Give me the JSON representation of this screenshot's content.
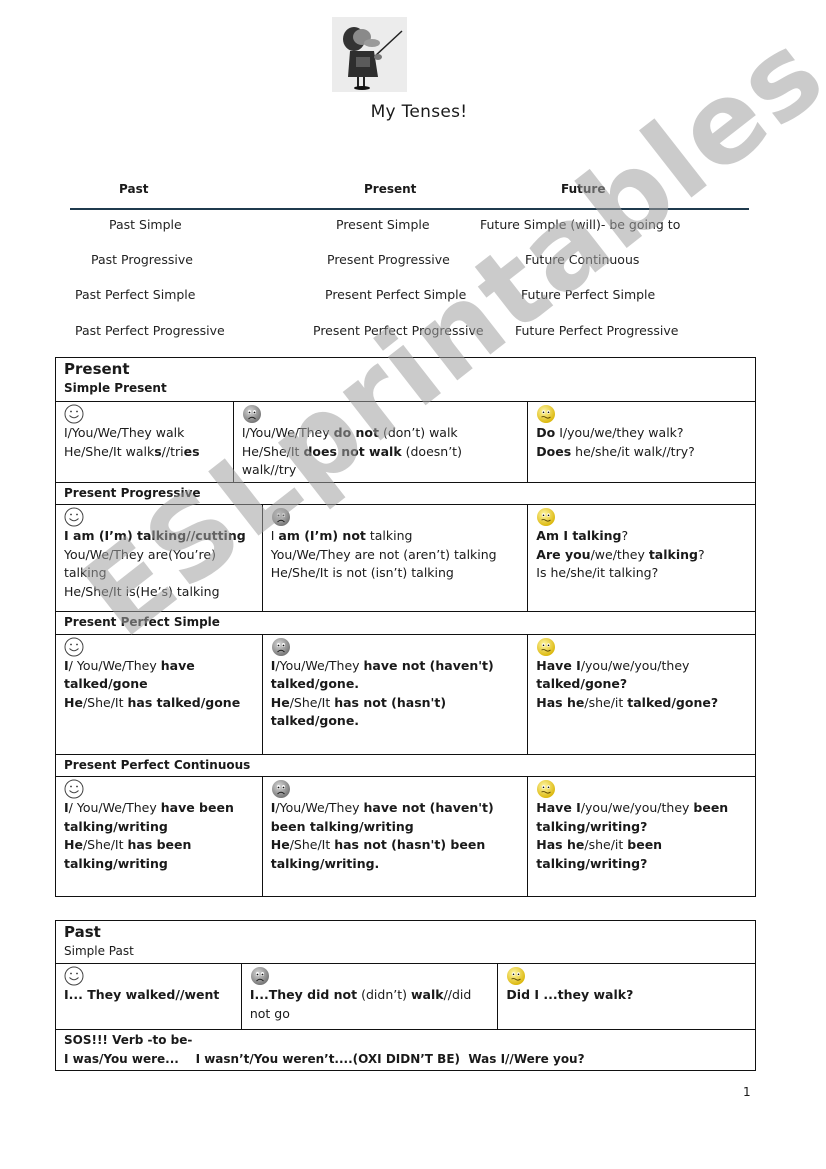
{
  "document": {
    "title": "My Tenses!",
    "page_number": "1",
    "watermark": "ESLprintables.com",
    "header_image": "teacher-with-pointer-image",
    "rule_color": "#1f3a4d"
  },
  "overview": {
    "headers": [
      "Past",
      "Present",
      "Future"
    ],
    "rows": [
      [
        "Past Simple",
        "Present Simple",
        "Future Simple (will)- be going to"
      ],
      [
        "Past Progressive",
        "Present Progressive",
        "Future Continuous"
      ],
      [
        "Past Perfect Simple",
        "Present Perfect Simple",
        "Future Perfect Simple"
      ],
      [
        "Past Perfect Progressive",
        "Present Perfect Progressive",
        "Future Perfect Progressive"
      ]
    ]
  },
  "icons": {
    "affirmative": "smiley-face-icon",
    "negative": "sad-face-icon",
    "question": "confused-face-icon"
  },
  "present": {
    "title": "Present",
    "simple": {
      "subtitle": "Simple Present",
      "affirmative": [
        [
          {
            "t": "I/You/We/They walk",
            "b": false
          }
        ],
        [
          {
            "t": "He/She/It walk",
            "b": false
          },
          {
            "t": "s",
            "b": true
          },
          {
            "t": "//tri",
            "b": false
          },
          {
            "t": "es",
            "b": true
          }
        ]
      ],
      "negative": [
        [
          {
            "t": "I/You/We/They ",
            "b": false
          },
          {
            "t": "do not",
            "b": true
          },
          {
            "t": " (don’t) walk",
            "b": false
          }
        ],
        [
          {
            "t": "He/She/It ",
            "b": false
          },
          {
            "t": "does not walk",
            "b": true
          },
          {
            "t": " (doesn’t) walk//try",
            "b": false
          }
        ]
      ],
      "question": [
        [
          {
            "t": "Do",
            "b": true
          },
          {
            "t": " I/you/we/they walk?",
            "b": false
          }
        ],
        [
          {
            "t": "Does",
            "b": true
          },
          {
            "t": " he/she/it walk//try?",
            "b": false
          }
        ]
      ]
    },
    "progressive": {
      "subtitle": "Present Progressive",
      "affirmative": [
        [
          {
            "t": "I am (I’m) talking//cutting",
            "b": true
          }
        ],
        [
          {
            "t": "You/We/They are(You’re) talking",
            "b": false
          }
        ],
        [
          {
            "t": "He/She/It is(He’s) talking",
            "b": false
          }
        ]
      ],
      "negative": [
        [
          {
            "t": "I ",
            "b": false
          },
          {
            "t": "am (I’m) not",
            "b": true
          },
          {
            "t": " talking",
            "b": false
          }
        ],
        [
          {
            "t": "You/We/They are not (aren’t) talking",
            "b": false
          }
        ],
        [
          {
            "t": "He/She/It is not (isn’t) talking",
            "b": false
          }
        ]
      ],
      "question": [
        [
          {
            "t": "Am I talking",
            "b": true
          },
          {
            "t": "?",
            "b": false
          }
        ],
        [
          {
            "t": "Are you",
            "b": true
          },
          {
            "t": "/we/they ",
            "b": false
          },
          {
            "t": "talking",
            "b": true
          },
          {
            "t": "?",
            "b": false
          }
        ],
        [
          {
            "t": "Is he/she/it talking?",
            "b": false
          }
        ]
      ]
    },
    "perfect_simple": {
      "subtitle": "Present Perfect Simple",
      "affirmative": [
        [
          {
            "t": "I",
            "b": true
          },
          {
            "t": "/ You/We/They ",
            "b": false
          },
          {
            "t": "have talked/gone",
            "b": true
          }
        ],
        [
          {
            "t": "He",
            "b": true
          },
          {
            "t": "/She/It ",
            "b": false
          },
          {
            "t": "has talked/gone",
            "b": true
          }
        ]
      ],
      "negative": [
        [
          {
            "t": "I",
            "b": true
          },
          {
            "t": "/You/We/They ",
            "b": false
          },
          {
            "t": "have not (haven't) talked/gone.",
            "b": true
          }
        ],
        [
          {
            "t": "He",
            "b": true
          },
          {
            "t": "/She/It ",
            "b": false
          },
          {
            "t": "has not (hasn't) talked/gone.",
            "b": true
          }
        ]
      ],
      "question": [
        [
          {
            "t": "Have I",
            "b": true
          },
          {
            "t": "/you/we/you/they ",
            "b": false
          },
          {
            "t": "talked/gone?",
            "b": true
          }
        ],
        [
          {
            "t": "Has he",
            "b": true
          },
          {
            "t": "/she/it ",
            "b": false
          },
          {
            "t": "talked/gone?",
            "b": true
          }
        ]
      ]
    },
    "perfect_continuous": {
      "subtitle": "Present Perfect Continuous",
      "affirmative": [
        [
          {
            "t": "I",
            "b": true
          },
          {
            "t": "/ You/We/They ",
            "b": false
          },
          {
            "t": "have been talking/writing",
            "b": true
          }
        ],
        [
          {
            "t": "He",
            "b": true
          },
          {
            "t": "/She/It ",
            "b": false
          },
          {
            "t": "has been talking/writing",
            "b": true
          }
        ]
      ],
      "negative": [
        [
          {
            "t": "I",
            "b": true
          },
          {
            "t": "/You/We/They ",
            "b": false
          },
          {
            "t": "have not (haven't) been talking/writing",
            "b": true
          }
        ],
        [
          {
            "t": "He",
            "b": true
          },
          {
            "t": "/She/It ",
            "b": false
          },
          {
            "t": "has not (hasn't) been talking/writing.",
            "b": true
          }
        ]
      ],
      "question": [
        [
          {
            "t": "Have I",
            "b": true
          },
          {
            "t": "/you/we/you/they ",
            "b": false
          },
          {
            "t": "been talking/writing?",
            "b": true
          }
        ],
        [
          {
            "t": "Has he",
            "b": true
          },
          {
            "t": "/she/it ",
            "b": false
          },
          {
            "t": "been talking/writing?",
            "b": true
          }
        ]
      ]
    }
  },
  "past": {
    "title": "Past",
    "simple": {
      "subtitle": "Simple Past",
      "affirmative": [
        [
          {
            "t": "I... They walked//went",
            "b": true
          }
        ]
      ],
      "negative": [
        [
          {
            "t": "I...They did not",
            "b": true
          },
          {
            "t": " (didn’t) ",
            "b": false
          },
          {
            "t": "walk",
            "b": true
          },
          {
            "t": "//did not go",
            "b": false
          }
        ]
      ],
      "question": [
        [
          {
            "t": "Did I ...they walk?",
            "b": true
          }
        ]
      ]
    },
    "sos": {
      "line1": "SOS!!! Verb -to be-",
      "line2": "I was/You were...    I wasn’t/You weren’t....(OXI DIDN’T BE)  Was I//Were you?"
    }
  }
}
